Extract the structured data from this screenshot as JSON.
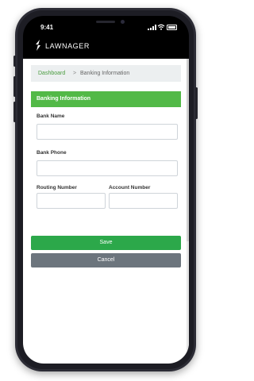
{
  "status_bar": {
    "time": "9:41"
  },
  "header": {
    "brand": "LAWNAGER"
  },
  "breadcrumb": {
    "home": "Dashboard",
    "separator": ">",
    "current": "Banking Information"
  },
  "form": {
    "title": "Banking Information",
    "bank_name": {
      "label": "Bank Name",
      "value": "",
      "placeholder": ""
    },
    "bank_phone": {
      "label": "Bank Phone",
      "value": "",
      "placeholder": ""
    },
    "routing_number": {
      "label": "Routing Number",
      "value": "",
      "placeholder": ""
    },
    "account_number": {
      "label": "Account Number",
      "value": "",
      "placeholder": ""
    }
  },
  "actions": {
    "save": "Save",
    "cancel": "Cancel"
  },
  "colors": {
    "accent_green": "#52b947",
    "save_green": "#2ca84a",
    "cancel_gray": "#6c757d",
    "breadcrumb_link": "#4a9c3f",
    "phone_frame": "#2c2c35"
  },
  "icons": {
    "logo": "lawnager-logo-icon",
    "signal": "signal-icon",
    "wifi": "wifi-icon",
    "battery": "battery-icon"
  }
}
